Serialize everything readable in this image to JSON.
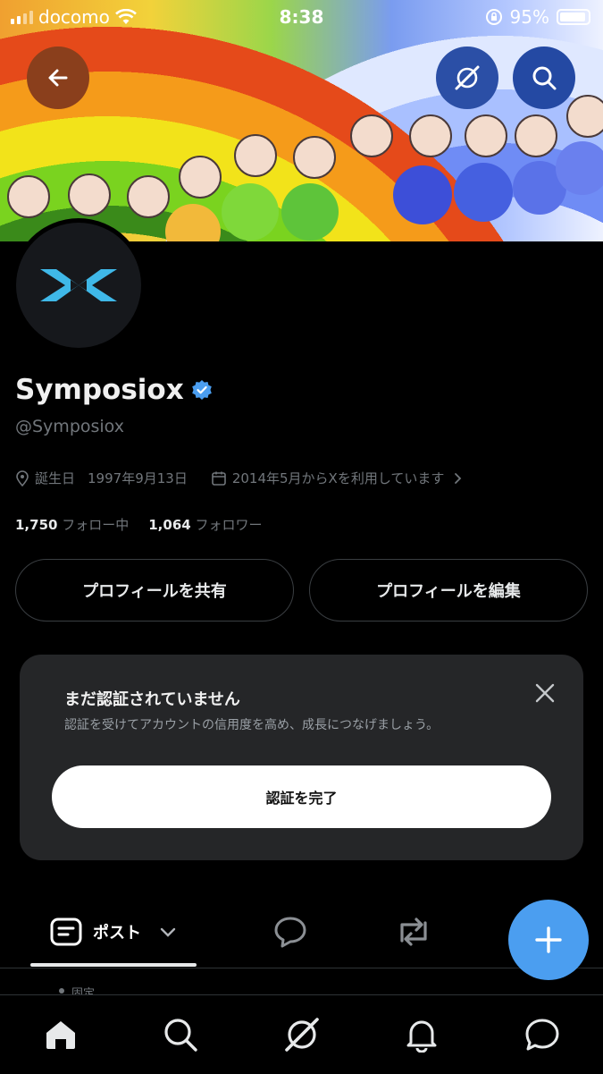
{
  "status_bar": {
    "carrier": "docomo",
    "time": "8:38",
    "battery": "95%"
  },
  "profile": {
    "name": "Symposiox",
    "handle": "@Symposiox",
    "birthday_label": "誕生日",
    "birthday": "1997年9月13日",
    "joined": "2014年5月からXを利用しています",
    "following_count": "1,750",
    "following_label": "フォロー中",
    "followers_count": "1,064",
    "followers_label": "フォロワー"
  },
  "buttons": {
    "share": "プロフィールを共有",
    "edit": "プロフィールを編集"
  },
  "verify_card": {
    "title": "まだ認証されていません",
    "subtitle": "認証を受けてアカウントの信用度を高め、成長につなげましょう。",
    "action": "認証を完了"
  },
  "tabs": {
    "posts": "ポスト"
  },
  "pinned_label": "固定",
  "colors": {
    "accent": "#4b9ef0",
    "logo": "#3fb8e8",
    "verified": "#4b9ef0",
    "background": "#000000",
    "card": "#252628"
  }
}
